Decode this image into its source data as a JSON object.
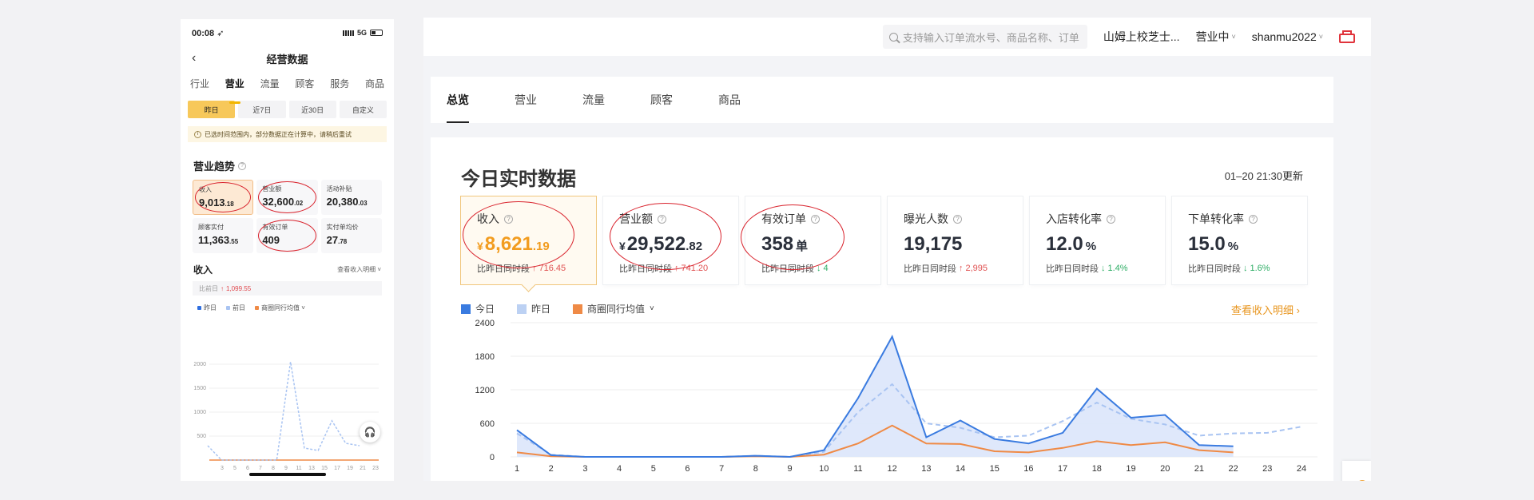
{
  "phone": {
    "time": "00:08 ➶",
    "network": "5G",
    "title": "经营数据",
    "tabs": [
      "行业",
      "营业",
      "流量",
      "顾客",
      "服务",
      "商品"
    ],
    "ranges": [
      "昨日",
      "近7日",
      "近30日",
      "自定义"
    ],
    "notice": "已选时间范围内，部分数据正在计算中，请稍后重试",
    "trend_title": "营业趋势",
    "cards": [
      {
        "label": "收入",
        "int": "9,013",
        "dec": ".18"
      },
      {
        "label": "营业额",
        "int": "32,600",
        "dec": ".02"
      },
      {
        "label": "活动补贴",
        "int": "20,380",
        "dec": ".03"
      },
      {
        "label": "顾客实付",
        "int": "11,363",
        "dec": ".55"
      },
      {
        "label": "有效订单",
        "int": "409",
        "dec": ""
      },
      {
        "label": "实付单均价",
        "int": "27",
        "dec": ".78"
      }
    ],
    "income_title": "收入",
    "income_link": "查看收入明细 ˅",
    "compare_label": "比前日",
    "compare_value": "1,099.55",
    "legend": [
      "昨日",
      "前日",
      "商圈同行均值 ˅"
    ]
  },
  "desktop": {
    "search_placeholder": "支持输入订单流水号、商品名称、订单",
    "store_name": "山姆上校芝士...",
    "status": "营业中",
    "user": "shanmu2022",
    "tabs": [
      "总览",
      "营业",
      "流量",
      "顾客",
      "商品"
    ],
    "panel_title": "今日实时数据",
    "update_time": "01–20 21:30更新",
    "metrics": [
      {
        "label": "收入",
        "currency": "¥",
        "int": "8,621",
        "dec": ".19",
        "unit": "",
        "compare": "比昨日同时段",
        "delta": "716.45",
        "dir": "up"
      },
      {
        "label": "营业额",
        "currency": "¥",
        "int": "29,522",
        "dec": ".82",
        "unit": "",
        "compare": "比昨日同时段",
        "delta": "741.20",
        "dir": "up"
      },
      {
        "label": "有效订单",
        "currency": "",
        "int": "358",
        "dec": "",
        "unit": "单",
        "compare": "比昨日同时段",
        "delta": "4",
        "dir": "down"
      },
      {
        "label": "曝光人数",
        "currency": "",
        "int": "19,175",
        "dec": "",
        "unit": "",
        "compare": "比昨日同时段",
        "delta": "2,995",
        "dir": "up"
      },
      {
        "label": "入店转化率",
        "currency": "",
        "int": "12.0",
        "dec": "",
        "unit": "%",
        "compare": "比昨日同时段",
        "delta": "1.4%",
        "dir": "down"
      },
      {
        "label": "下单转化率",
        "currency": "",
        "int": "15.0",
        "dec": "",
        "unit": "%",
        "compare": "比昨日同时段",
        "delta": "1.6%",
        "dir": "down"
      }
    ],
    "legend": [
      "今日",
      "昨日",
      "商圈同行均值"
    ],
    "detail_link": "查看收入明细 ›"
  },
  "chart_data": [
    {
      "type": "area",
      "x": [
        1,
        2,
        3,
        4,
        5,
        6,
        7,
        8,
        9,
        10,
        11,
        12,
        13,
        14,
        15,
        16,
        17,
        18,
        19,
        20,
        21,
        22,
        23,
        24
      ],
      "ylim": [
        0,
        2400
      ],
      "yticks": [
        0,
        600,
        1200,
        1800,
        2400
      ],
      "series": [
        {
          "name": "今日",
          "color": "#3a7be0",
          "values": [
            480,
            30,
            0,
            0,
            0,
            0,
            0,
            20,
            0,
            120,
            1050,
            2150,
            350,
            650,
            320,
            240,
            430,
            1220,
            700,
            750,
            210,
            190,
            null,
            null
          ]
        },
        {
          "name": "昨日",
          "color": "#a9c4f2",
          "values": [
            420,
            40,
            0,
            0,
            0,
            0,
            0,
            20,
            0,
            90,
            800,
            1300,
            600,
            520,
            350,
            380,
            640,
            970,
            680,
            580,
            380,
            420,
            430,
            540
          ]
        },
        {
          "name": "商圈同行均值",
          "color": "#ef8a46",
          "values": [
            80,
            10,
            0,
            0,
            0,
            0,
            0,
            10,
            0,
            40,
            240,
            560,
            240,
            230,
            100,
            80,
            160,
            280,
            210,
            260,
            120,
            80,
            null,
            null
          ]
        }
      ]
    },
    {
      "type": "line",
      "x": [
        1,
        3,
        5,
        7,
        9,
        11,
        13,
        15,
        17,
        19,
        21,
        23
      ],
      "xticks": [
        "3",
        "5",
        "6",
        "7",
        "8",
        "9",
        "11",
        "13",
        "15",
        "17",
        "19",
        "21",
        "23"
      ],
      "ylim": [
        0,
        2000
      ],
      "yticks": [
        500,
        1000,
        1500,
        2000
      ],
      "series": [
        {
          "name": "昨日",
          "color": "#2f6fe0",
          "values": [
            0,
            0,
            0,
            0,
            0,
            0,
            0,
            0,
            0,
            0,
            0,
            0
          ]
        },
        {
          "name": "前日",
          "color": "#a9c4f2",
          "values": [
            300,
            0,
            0,
            0,
            0,
            0,
            2050,
            250,
            200,
            820,
            350,
            300
          ]
        },
        {
          "name": "商圈同行均值",
          "color": "#ef8a46",
          "values": [
            0,
            0,
            0,
            0,
            0,
            0,
            0,
            0,
            0,
            0,
            0,
            0
          ]
        }
      ]
    }
  ]
}
